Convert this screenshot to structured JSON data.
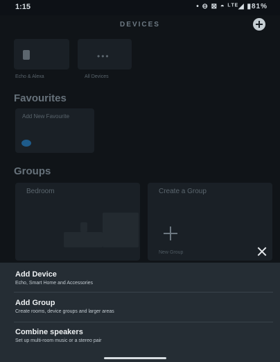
{
  "status_bar": {
    "time": "1:15",
    "icons": "• ⊖ ⊠ ◓ ᴸᵀᴱ◢ ▮81%",
    "battery": "81%"
  },
  "header": {
    "title": "DEVICES"
  },
  "device_tiles": [
    {
      "label": "Echo & Alexa",
      "icon": "echo-device-icon"
    },
    {
      "label": "All Devices",
      "icon": "more-dots-icon"
    }
  ],
  "favourites": {
    "title": "Favourites",
    "add_tile_label": "Add New Favourite"
  },
  "groups": {
    "title": "Groups",
    "items": [
      {
        "label": "Bedroom"
      },
      {
        "label": "Create a Group",
        "sub_label": "New Group"
      }
    ]
  },
  "sheet": {
    "items": [
      {
        "title": "Add Device",
        "subtitle": "Echo, Smart Home and Accessories"
      },
      {
        "title": "Add Group",
        "subtitle": "Create rooms, device groups and larger areas"
      },
      {
        "title": "Combine speakers",
        "subtitle": "Set up multi-room music or a stereo pair"
      }
    ]
  },
  "colors": {
    "background": "#101418",
    "sheet": "#252d34",
    "accent": "#1e5b8a"
  }
}
